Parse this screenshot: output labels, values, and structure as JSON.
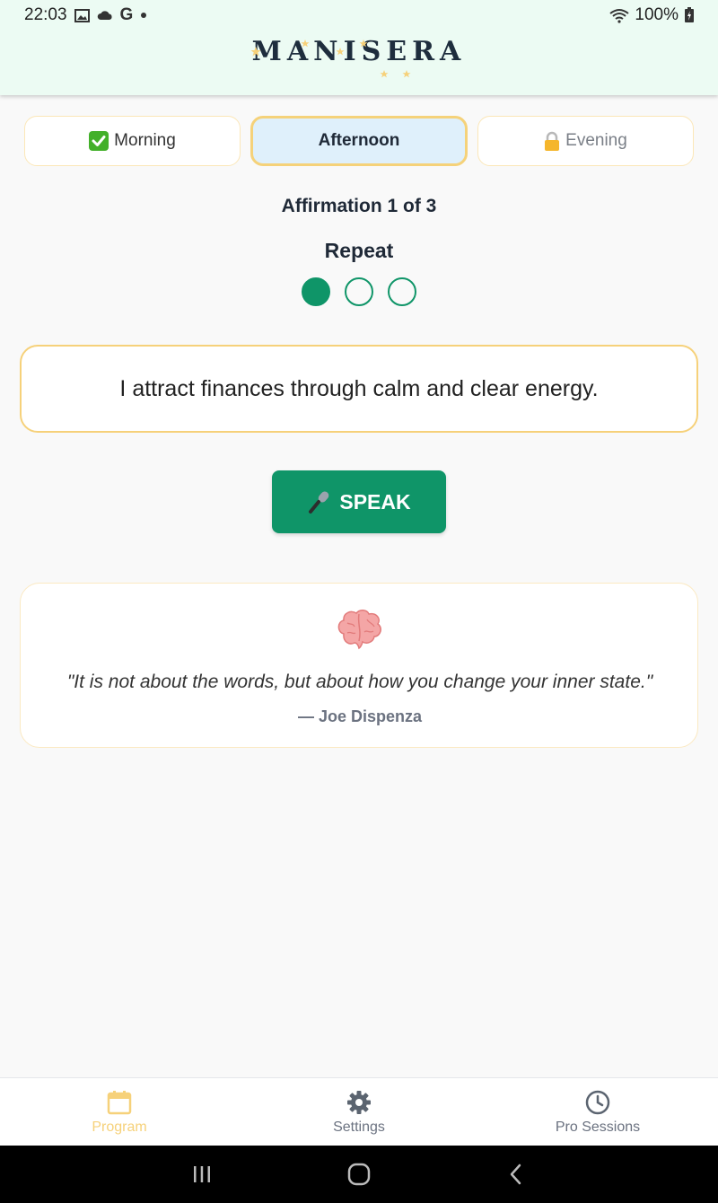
{
  "status_bar": {
    "time": "22:03",
    "battery": "100%",
    "left_icons": [
      "image-icon",
      "cloud-icon",
      "google-icon",
      "dot-icon"
    ],
    "right_icons": [
      "wifi-icon",
      "battery-icon"
    ]
  },
  "header": {
    "logo_text": "MANISERA"
  },
  "tabs": [
    {
      "label": "Morning",
      "icon": "check-icon",
      "state": "completed"
    },
    {
      "label": "Afternoon",
      "icon": "",
      "state": "active"
    },
    {
      "label": "Evening",
      "icon": "lock-icon",
      "state": "locked"
    }
  ],
  "main": {
    "counter": "Affirmation 1 of 3",
    "repeat_label": "Repeat",
    "repeats_total": 3,
    "repeats_done": 1,
    "affirmation": "I attract finances through calm and clear energy.",
    "speak_label": "SPEAK",
    "speak_icon": "microphone-icon"
  },
  "quote": {
    "icon": "brain-icon",
    "text": "\"It is not about the words, but about how you change your inner state.\"",
    "author": "— Joe Dispenza"
  },
  "bottom_nav": [
    {
      "label": "Program",
      "icon": "calendar-icon",
      "active": true
    },
    {
      "label": "Settings",
      "icon": "gear-icon",
      "active": false
    },
    {
      "label": "Pro Sessions",
      "icon": "clock-icon",
      "active": false
    }
  ],
  "colors": {
    "header_bg": "#ecfbf3",
    "accent_green": "#0f9568",
    "accent_gold": "#f6d17a",
    "active_tab_bg": "#dff0fb"
  }
}
